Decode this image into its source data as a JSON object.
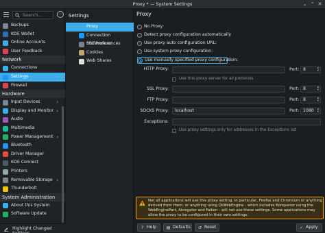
{
  "window": {
    "title": "Proxy * — System Settings",
    "minimize": "⌄",
    "maximize": "⌃",
    "close": "✕"
  },
  "sidebar": {
    "search_placeholder": "Search...",
    "items": [
      {
        "label": "Backups",
        "icon": "backups-icon",
        "color": "#7a8592",
        "type": "item"
      },
      {
        "label": "KDE Wallet",
        "icon": "wallet-icon",
        "color": "#2f6fb5",
        "type": "item"
      },
      {
        "label": "Online Accounts",
        "icon": "online-accounts-icon",
        "color": "#3daee9",
        "type": "item"
      },
      {
        "label": "User Feedback",
        "icon": "feedback-icon",
        "color": "#da4453",
        "type": "item"
      },
      {
        "label": "Network",
        "type": "category"
      },
      {
        "label": "Connections",
        "icon": "connections-icon",
        "color": "#3daee9",
        "type": "item"
      },
      {
        "label": "Settings",
        "icon": "network-settings-icon",
        "color": "#1d99f3",
        "type": "item",
        "selected": true,
        "chevron": true
      },
      {
        "label": "Firewall",
        "icon": "firewall-icon",
        "color": "#da4453",
        "type": "item"
      },
      {
        "label": "Hardware",
        "type": "category"
      },
      {
        "label": "Input Devices",
        "icon": "input-devices-icon",
        "color": "#7a8592",
        "type": "item",
        "chevron": true
      },
      {
        "label": "Display and Monitor",
        "icon": "display-icon",
        "color": "#3daee9",
        "type": "item",
        "chevron": true
      },
      {
        "label": "Audio",
        "icon": "audio-icon",
        "color": "#9b59b6",
        "type": "item"
      },
      {
        "label": "Multimedia",
        "icon": "multimedia-icon",
        "color": "#1abc9c",
        "type": "item"
      },
      {
        "label": "Power Management",
        "icon": "power-icon",
        "color": "#27ae60",
        "type": "item",
        "chevron": true
      },
      {
        "label": "Bluetooth",
        "icon": "bluetooth-icon",
        "color": "#1d99f3",
        "type": "item"
      },
      {
        "label": "Driver Manager",
        "icon": "driver-icon",
        "color": "#e74c3c",
        "type": "item"
      },
      {
        "label": "KDE Connect",
        "icon": "kde-connect-icon",
        "color": "#4d5a66",
        "type": "item"
      },
      {
        "label": "Printers",
        "icon": "printer-icon",
        "color": "#95a5a6",
        "type": "item"
      },
      {
        "label": "Removable Storage",
        "icon": "storage-icon",
        "color": "#7a8592",
        "type": "item",
        "chevron": true
      },
      {
        "label": "Thunderbolt",
        "icon": "thunderbolt-icon",
        "color": "#f1c40f",
        "type": "item"
      },
      {
        "label": "System Administration",
        "type": "category"
      },
      {
        "label": "About this System",
        "icon": "info-icon",
        "color": "#3daee9",
        "type": "item"
      },
      {
        "label": "Software Update",
        "icon": "update-icon",
        "color": "#27ae60",
        "type": "item"
      }
    ],
    "highlight_label": "Highlight Changed Settings"
  },
  "mid": {
    "heading": "Settings",
    "items": [
      {
        "label": "Proxy",
        "icon": "proxy-icon",
        "color": "#3daee9",
        "selected": true
      },
      {
        "label": "Connection Preferences",
        "icon": "connection-prefs-icon",
        "color": "#1d99f3"
      },
      {
        "label": "SSL Preferences",
        "icon": "ssl-icon",
        "color": "#7a8592"
      },
      {
        "label": "Cookies",
        "icon": "cookies-icon",
        "color": "#c8a46e"
      },
      {
        "label": "Web Shares",
        "icon": "share-icon",
        "color": "#dfe1e3"
      }
    ]
  },
  "content": {
    "heading": "Proxy",
    "radios": [
      {
        "label": "No Proxy",
        "checked": false
      },
      {
        "label": "Detect proxy configuration automatically",
        "checked": false
      },
      {
        "label": "Use proxy auto configuration URL:",
        "checked": false
      },
      {
        "label": "Use system proxy configuration:",
        "checked": false
      },
      {
        "label": "Use manually specified proxy configuration:",
        "checked": true
      }
    ],
    "http": {
      "label": "HTTP Proxy:",
      "value": "",
      "port_label": "Port:",
      "port": "8"
    },
    "use_for_all": "Use this proxy server for all protocols",
    "ssl": {
      "label": "SSL Proxy:",
      "value": "",
      "port_label": "Port:",
      "port": "8"
    },
    "ftp": {
      "label": "FTP Proxy:",
      "value": "",
      "port_label": "Port:",
      "port": "8"
    },
    "socks": {
      "label": "SOCKS Proxy:",
      "value": "localhost",
      "port_label": "Port:",
      "port": "1080"
    },
    "exceptions": {
      "label": "Exceptions:",
      "value": ""
    },
    "exceptions_only": "Use proxy settings only for addresses in the Exceptions list",
    "warning": "Not all applications will use this proxy setting. In particular, Firefox and Chromium or anything derived from them, or anything using QtWebEngine - which includes Konqueror using the WebEnginePart, Akregator and Falkon - will not use these settings. Some applications may allow the proxy to be configured in their own settings.",
    "buttons": {
      "help": "Help",
      "defaults": "Defaults",
      "reset": "Reset",
      "apply": "Apply"
    }
  },
  "colors": {
    "accent": "#3daee9",
    "warning": "#f6a41a",
    "background": "#1b1e20",
    "panel": "#202326"
  }
}
